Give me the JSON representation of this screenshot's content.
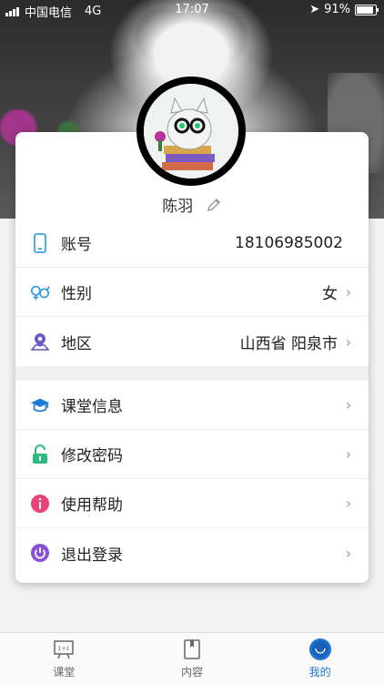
{
  "status_bar": {
    "carrier": "中国电信",
    "network": "4G",
    "time": "17:07",
    "battery": "91%"
  },
  "profile": {
    "name": "陈羽"
  },
  "info_rows": [
    {
      "label": "账号",
      "value": "18106985002",
      "icon": "phone-icon"
    },
    {
      "label": "性别",
      "value": "女",
      "icon": "gender-icon"
    },
    {
      "label": "地区",
      "value": "山西省 阳泉市",
      "icon": "location-icon"
    }
  ],
  "menu_rows": [
    {
      "label": "课堂信息",
      "icon": "graduation-cap-icon"
    },
    {
      "label": "修改密码",
      "icon": "lock-icon"
    },
    {
      "label": "使用帮助",
      "icon": "info-icon"
    },
    {
      "label": "退出登录",
      "icon": "power-icon"
    }
  ],
  "tabs": [
    {
      "label": "课堂",
      "icon": "classroom-board-icon",
      "active": false
    },
    {
      "label": "内容",
      "icon": "book-icon",
      "active": false
    },
    {
      "label": "我的",
      "icon": "profile-icon",
      "active": true
    }
  ],
  "colors": {
    "accent": "#1f73d6",
    "phone": "#3aa6e8",
    "gender": "#2a9be0",
    "location": "#6a57c4",
    "cap": "#1e7ad9",
    "lock": "#2fb87f",
    "info": "#e8437a",
    "power": "#8b4ed6"
  }
}
